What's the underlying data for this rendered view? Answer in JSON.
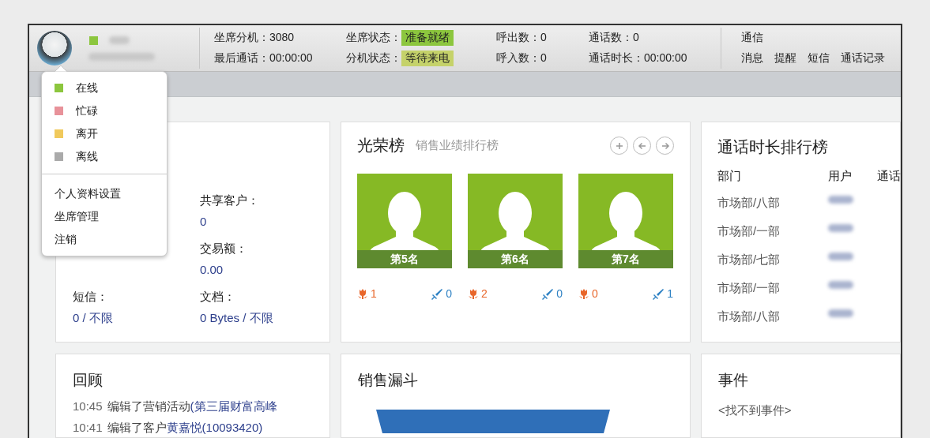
{
  "header": {
    "stat_columns": [
      {
        "kind": "text",
        "items": [
          {
            "text": "坐席分机：3080"
          },
          {
            "text": "最后通话：00:00:00"
          }
        ]
      },
      {
        "kind": "badge",
        "items": [
          {
            "label": "坐席状态：",
            "value": "准备就绪",
            "color": "#8cc63e"
          },
          {
            "label": "分机状态：",
            "value": "等待来电",
            "color": "#c5d26a"
          }
        ]
      },
      {
        "kind": "text",
        "items": [
          {
            "text": "呼出数：0"
          },
          {
            "text": "呼入数：0"
          }
        ]
      },
      {
        "kind": "text",
        "items": [
          {
            "text": "通话数：0"
          },
          {
            "text": "通话时长：00:00:00"
          }
        ]
      }
    ],
    "comms": {
      "title": "通信",
      "links": [
        "消息",
        "提醒",
        "短信",
        "通话记录"
      ]
    },
    "user": {
      "color": "#8cc63e"
    }
  },
  "presence_menu": {
    "statuses": [
      {
        "label": "在线",
        "color": "#8cc63e"
      },
      {
        "label": "忙碌",
        "color": "#e8929a"
      },
      {
        "label": "离开",
        "color": "#f0c95c"
      },
      {
        "label": "离线",
        "color": "#aaaaaa"
      }
    ],
    "actions": [
      "个人资料设置",
      "坐席管理",
      "注销"
    ]
  },
  "overview": {
    "right_column": [
      {
        "label": "共享客户：",
        "value": "0"
      },
      {
        "label": "交易额：",
        "value": "0.00"
      },
      {
        "label": "文档：",
        "value": "0 Bytes / 不限"
      }
    ],
    "left_column": [
      {
        "label": "短信：",
        "value": "0 / 不限"
      }
    ]
  },
  "honor_board": {
    "title": "光荣榜",
    "subtitle": "销售业绩排行榜",
    "people": [
      {
        "rank": "第5名",
        "flowers": "1",
        "votes": "0"
      },
      {
        "rank": "第6名",
        "flowers": "2",
        "votes": "0"
      },
      {
        "rank": "第7名",
        "flowers": "0",
        "votes": "1"
      }
    ]
  },
  "call_ranking": {
    "title": "通话时长排行榜",
    "columns": [
      "部门",
      "用户",
      "通话"
    ],
    "rows": [
      {
        "department": "市场部/八部"
      },
      {
        "department": "市场部/一部"
      },
      {
        "department": "市场部/七部"
      },
      {
        "department": "市场部/一部"
      },
      {
        "department": "市场部/八部"
      }
    ]
  },
  "review": {
    "title": "回顾",
    "entries": [
      {
        "time": "10:45",
        "action": "编辑了营销活动",
        "target": "(第三届财富高峰"
      },
      {
        "time": "10:41",
        "action": "编辑了客户",
        "target": "黄嘉悦(10093420)"
      }
    ]
  },
  "funnel": {
    "title": "销售漏斗"
  },
  "events": {
    "title": "事件",
    "empty_text": "<找不到事件>"
  }
}
